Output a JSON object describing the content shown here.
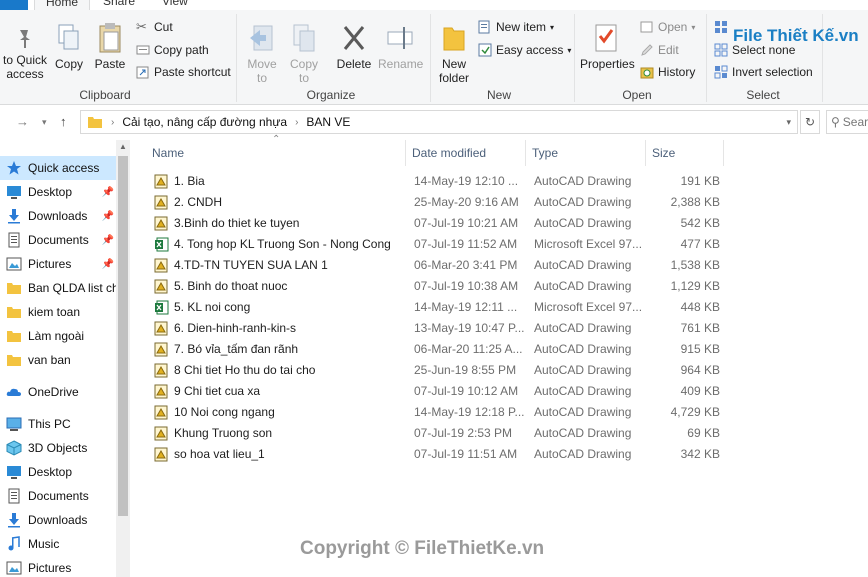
{
  "tabs": {
    "home": "Home",
    "share": "Share",
    "view": "View"
  },
  "ribbon": {
    "clipboard": {
      "label": "Clipboard",
      "pin": "to Quick access",
      "copy": "Copy",
      "paste": "Paste",
      "cut": "Cut",
      "copy_path": "Copy path",
      "paste_shortcut": "Paste shortcut"
    },
    "organize": {
      "label": "Organize",
      "move_to": "Move to",
      "copy_to": "Copy to",
      "delete": "Delete",
      "rename": "Rename"
    },
    "new": {
      "label": "New",
      "new_folder": "New folder",
      "new_item": "New item",
      "easy_access": "Easy access"
    },
    "open": {
      "label": "Open",
      "properties": "Properties",
      "open": "Open",
      "edit": "Edit",
      "history": "History"
    },
    "select": {
      "label": "Select",
      "select_all": "Select all",
      "select_none": "Select none",
      "invert_selection": "Invert selection"
    }
  },
  "address": {
    "crumbs": [
      "Cải tạo, nâng cấp đường nhựa",
      "BAN VE"
    ],
    "search_placeholder": "Search"
  },
  "navpane": {
    "items": [
      {
        "label": "Quick access",
        "icon": "star-icon",
        "pinned": false,
        "selected": true
      },
      {
        "label": "Desktop",
        "icon": "desktop-icon",
        "pinned": true
      },
      {
        "label": "Downloads",
        "icon": "download-icon",
        "pinned": true
      },
      {
        "label": "Documents",
        "icon": "documents-icon",
        "pinned": true
      },
      {
        "label": "Pictures",
        "icon": "pictures-icon",
        "pinned": true
      },
      {
        "label": "Ban QLDA list ch",
        "icon": "folder-icon",
        "pinned": false
      },
      {
        "label": "kiem toan",
        "icon": "folder-icon",
        "pinned": false
      },
      {
        "label": "Làm ngoài",
        "icon": "folder-icon",
        "pinned": false
      },
      {
        "label": "van ban",
        "icon": "folder-icon",
        "pinned": false
      },
      {
        "label": "OneDrive",
        "icon": "cloud-icon",
        "pinned": false
      },
      {
        "label": "This PC",
        "icon": "computer-icon",
        "pinned": false
      },
      {
        "label": "3D Objects",
        "icon": "cube-icon",
        "pinned": false
      },
      {
        "label": "Desktop",
        "icon": "desktop-icon",
        "pinned": false
      },
      {
        "label": "Documents",
        "icon": "documents-icon",
        "pinned": false
      },
      {
        "label": "Downloads",
        "icon": "download-icon",
        "pinned": false
      },
      {
        "label": "Music",
        "icon": "music-icon",
        "pinned": false
      },
      {
        "label": "Pictures",
        "icon": "pictures-icon",
        "pinned": false
      }
    ]
  },
  "columns": {
    "name": "Name",
    "date": "Date modified",
    "type": "Type",
    "size": "Size"
  },
  "files": [
    {
      "name": "1. Bia",
      "date": "14-May-19 12:10 ...",
      "type": "AutoCAD Drawing",
      "size": "191 KB",
      "kind": "dwg"
    },
    {
      "name": "2. CNDH",
      "date": "25-May-20 9:16 AM",
      "type": "AutoCAD Drawing",
      "size": "2,388 KB",
      "kind": "dwg"
    },
    {
      "name": "3.Binh do thiet ke tuyen",
      "date": "07-Jul-19 10:21 AM",
      "type": "AutoCAD Drawing",
      "size": "542 KB",
      "kind": "dwg"
    },
    {
      "name": "4. Tong hop KL Truong Son - Nong Cong",
      "date": "07-Jul-19 11:52 AM",
      "type": "Microsoft Excel 97...",
      "size": "477 KB",
      "kind": "xls"
    },
    {
      "name": "4.TD-TN TUYEN SUA LAN 1",
      "date": "06-Mar-20 3:41 PM",
      "type": "AutoCAD Drawing",
      "size": "1,538 KB",
      "kind": "dwg"
    },
    {
      "name": "5. Binh do thoat nuoc",
      "date": "07-Jul-19 10:38 AM",
      "type": "AutoCAD Drawing",
      "size": "1,129 KB",
      "kind": "dwg"
    },
    {
      "name": "5. KL noi cong",
      "date": "14-May-19 12:11 ...",
      "type": "Microsoft Excel 97...",
      "size": "448 KB",
      "kind": "xls"
    },
    {
      "name": "6. Dien-hinh-ranh-kin-s",
      "date": "13-May-19 10:47 P...",
      "type": "AutoCAD Drawing",
      "size": "761 KB",
      "kind": "dwg"
    },
    {
      "name": "7. Bó vỉa_tấm đan rãnh",
      "date": "06-Mar-20 11:25 A...",
      "type": "AutoCAD Drawing",
      "size": "915 KB",
      "kind": "dwg"
    },
    {
      "name": "8 Chi tiet Ho thu do tai cho",
      "date": "25-Jun-19 8:55 PM",
      "type": "AutoCAD Drawing",
      "size": "964 KB",
      "kind": "dwg"
    },
    {
      "name": "9 Chi tiet cua xa",
      "date": "07-Jul-19 10:12 AM",
      "type": "AutoCAD Drawing",
      "size": "409 KB",
      "kind": "dwg"
    },
    {
      "name": "10 Noi cong ngang",
      "date": "14-May-19 12:18 P...",
      "type": "AutoCAD Drawing",
      "size": "4,729 KB",
      "kind": "dwg"
    },
    {
      "name": "Khung Truong son",
      "date": "07-Jul-19 2:53 PM",
      "type": "AutoCAD Drawing",
      "size": "69 KB",
      "kind": "dwg"
    },
    {
      "name": "so hoa vat lieu_1",
      "date": "07-Jul-19 11:51 AM",
      "type": "AutoCAD Drawing",
      "size": "342 KB",
      "kind": "dwg"
    }
  ],
  "watermark": "Copyright © FileThietKe.vn",
  "logo": "File Thiết Kế.vn",
  "colors": {
    "accent": "#1979ca",
    "selection": "#cce8ff",
    "header_text": "#4c607a"
  }
}
